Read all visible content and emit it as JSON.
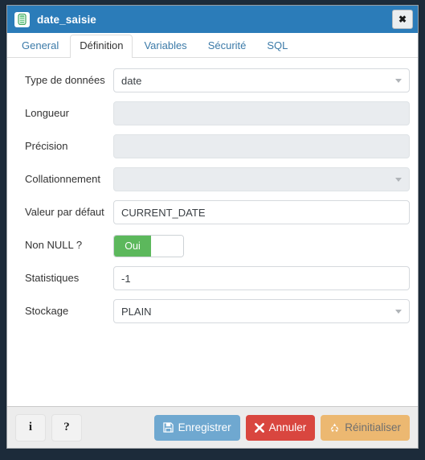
{
  "window": {
    "title": "date_saisie",
    "icon": "column-icon",
    "close_label": "✖"
  },
  "tabs": [
    {
      "label": "General",
      "active": false
    },
    {
      "label": "Définition",
      "active": true
    },
    {
      "label": "Variables",
      "active": false
    },
    {
      "label": "Sécurité",
      "active": false
    },
    {
      "label": "SQL",
      "active": false
    }
  ],
  "form": {
    "fields": [
      {
        "label": "Type de données",
        "value": "date",
        "type": "select",
        "disabled": false
      },
      {
        "label": "Longueur",
        "value": "",
        "type": "text",
        "disabled": true
      },
      {
        "label": "Précision",
        "value": "",
        "type": "text",
        "disabled": true
      },
      {
        "label": "Collationnement",
        "value": "",
        "type": "select",
        "disabled": true
      },
      {
        "label": "Valeur par défaut",
        "value": "CURRENT_DATE",
        "type": "text",
        "disabled": false
      },
      {
        "label": "Non NULL ?",
        "value": "Oui",
        "type": "toggle",
        "disabled": false
      },
      {
        "label": "Statistiques",
        "value": "-1",
        "type": "text",
        "disabled": false
      },
      {
        "label": "Stockage",
        "value": "PLAIN",
        "type": "select",
        "disabled": false
      }
    ]
  },
  "footer": {
    "info_label": "i",
    "help_label": "?",
    "save_label": "Enregistrer",
    "cancel_label": "Annuler",
    "reset_label": "Réinitialiser"
  },
  "colors": {
    "titlebar": "#2b7cb9",
    "toggle_on": "#5cb85c",
    "save": "#6fa8d0",
    "cancel": "#d9463f",
    "reset": "#ecb871",
    "tab_link": "#3b7aa8"
  }
}
